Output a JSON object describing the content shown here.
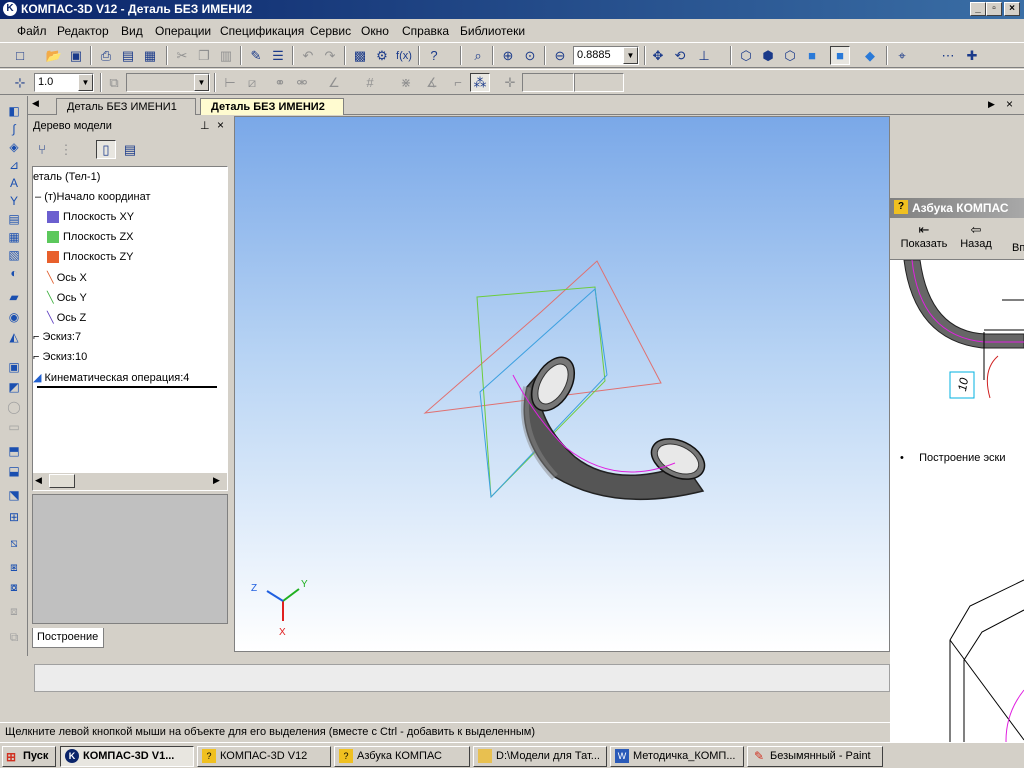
{
  "window": {
    "title": "КОМПАС-3D V12 - Деталь БЕЗ ИМЕНИ2"
  },
  "menu": [
    "Файл",
    "Редактор",
    "Вид",
    "Операции",
    "Спецификация",
    "Сервис",
    "Окно",
    "Справка",
    "Библиотеки"
  ],
  "toolbar": {
    "zoom_value": "0.8885",
    "line_scale": "1.0"
  },
  "tabs": [
    "Деталь БЕЗ ИМЕНИ1",
    "Деталь БЕЗ ИМЕНИ2"
  ],
  "tree": {
    "title": "Дерево модели",
    "items": [
      {
        "label": "еталь (Тел-1)",
        "color": ""
      },
      {
        "label": "(т)Начало координат",
        "color": ""
      },
      {
        "label": "Плоскость XY",
        "color": "#6b5fcf"
      },
      {
        "label": "Плоскость ZX",
        "color": "#5cc85c"
      },
      {
        "label": "Плоскость ZY",
        "color": "#e8602c"
      },
      {
        "label": "Ось X",
        "color": "#e06030"
      },
      {
        "label": "Ось Y",
        "color": "#40b040"
      },
      {
        "label": "Ось Z",
        "color": "#6040c0"
      },
      {
        "label": "Эскиз:7",
        "color": ""
      },
      {
        "label": "Эскиз:10",
        "color": ""
      },
      {
        "label": "Кинематическая операция:4",
        "color": "#2060d0"
      }
    ],
    "tab": "Построение"
  },
  "viewport": {
    "axis_x": "X",
    "axis_y": "Y",
    "axis_z": "Z"
  },
  "side_window": {
    "title": "Азбука КОМПАС",
    "btn_show": "Показать",
    "btn_back": "Назад",
    "btn_more": "Вп",
    "dim_label": "10",
    "bullet": "Построение эски"
  },
  "status": {
    "text": "Щелкните левой кнопкой мыши на объекте для его выделения (вместе с Ctrl - добавить к выделенным)"
  },
  "taskbar": {
    "start": "Пуск",
    "items": [
      "КОМПАС-3D V1...",
      "КОМПАС-3D V12",
      "Азбука КОМПАС",
      "D:\\Модели для Тат...",
      "Методичка_КОМП...",
      "Безымянный - Paint"
    ]
  }
}
